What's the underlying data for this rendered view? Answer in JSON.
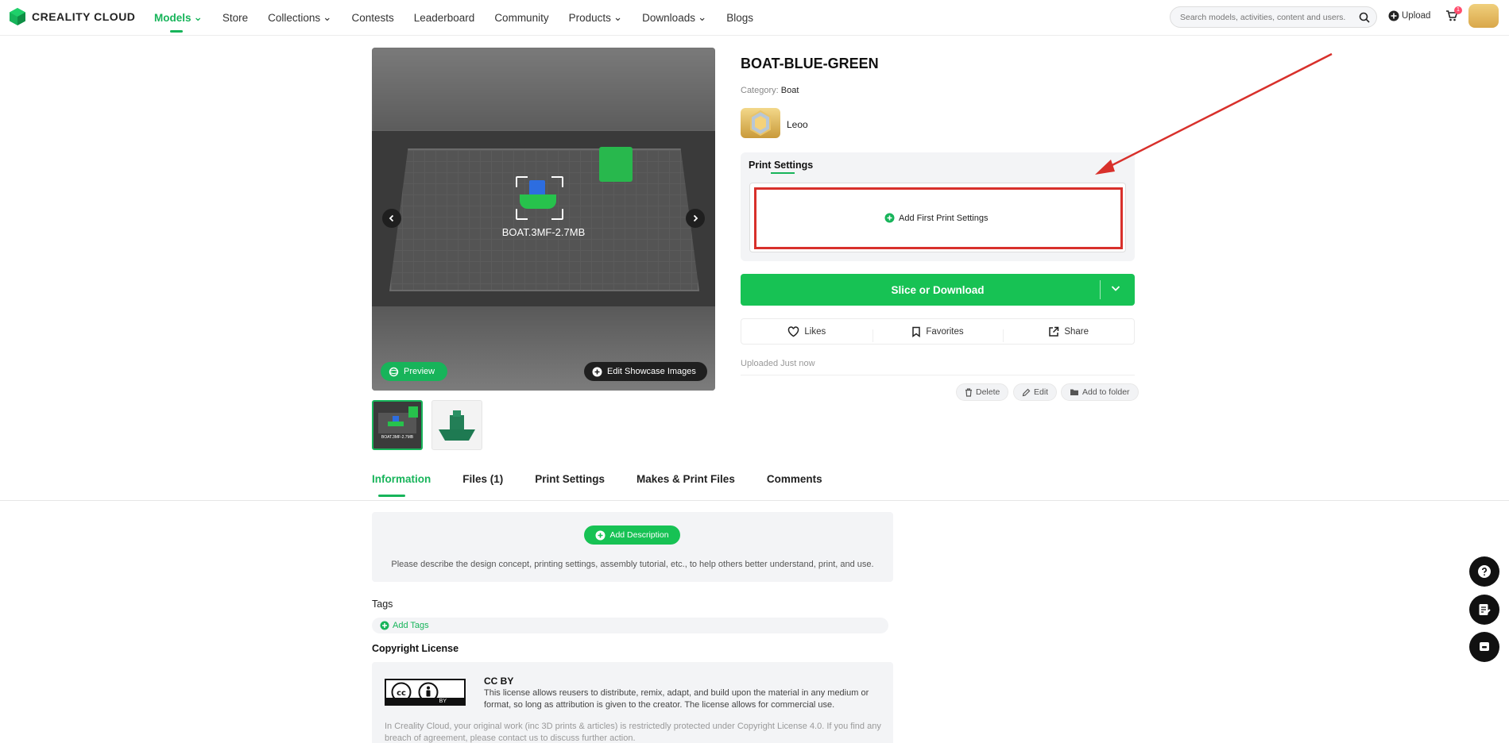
{
  "header": {
    "logo_text": "CREALITY CLOUD",
    "nav": [
      {
        "label": "Models",
        "dropdown": true,
        "active": true
      },
      {
        "label": "Store",
        "dropdown": false
      },
      {
        "label": "Collections",
        "dropdown": true
      },
      {
        "label": "Contests",
        "dropdown": false
      },
      {
        "label": "Leaderboard",
        "dropdown": false
      },
      {
        "label": "Community",
        "dropdown": false
      },
      {
        "label": "Products",
        "dropdown": true
      },
      {
        "label": "Downloads",
        "dropdown": true
      },
      {
        "label": "Blogs",
        "dropdown": false
      }
    ],
    "search_placeholder": "Search models, activities, content and users.",
    "upload_label": "Upload",
    "cart_badge": "1"
  },
  "gallery": {
    "file_label": "BOAT.3MF-2.7MB",
    "preview_label": "Preview",
    "edit_showcase_label": "Edit Showcase Images",
    "thumb1_label": "BOAT.3MF-2.7MB"
  },
  "model": {
    "title": "BOAT-BLUE-GREEN",
    "category_prefix": "Category:",
    "category": "Boat",
    "author": "Leoo"
  },
  "print_settings": {
    "title": "Print Settings",
    "add_label": "Add First Print Settings"
  },
  "slice_button": "Slice or Download",
  "actions": {
    "likes": "Likes",
    "favorites": "Favorites",
    "share": "Share"
  },
  "uploaded": "Uploaded Just now",
  "owner_actions": {
    "delete": "Delete",
    "edit": "Edit",
    "add_to_folder": "Add to folder"
  },
  "tabs": [
    "Information",
    "Files (1)",
    "Print Settings",
    "Makes & Print Files",
    "Comments"
  ],
  "information": {
    "add_description": "Add Description",
    "description_hint": "Please describe the design concept, printing settings, assembly tutorial, etc., to help others better understand, print, and use.",
    "tags_label": "Tags",
    "add_tags": "Add Tags",
    "copyright_label": "Copyright License",
    "license_title": "CC BY",
    "license_text": "This license allows reusers to distribute, remix, adapt, and build upon the material in any medium or format, so long as attribution is given to the creator. The license allows for commercial use.",
    "license_footer": "In Creality Cloud, your original work (inc 3D prints & articles) is restrictedly protected under Copyright License 4.0. If you find any breach of agreement, please contact us to discuss further action.",
    "cc_badge_text": "BY"
  },
  "colors": {
    "accent": "#17b45a",
    "button_green": "#17c254",
    "highlight_red": "#d8302b"
  }
}
